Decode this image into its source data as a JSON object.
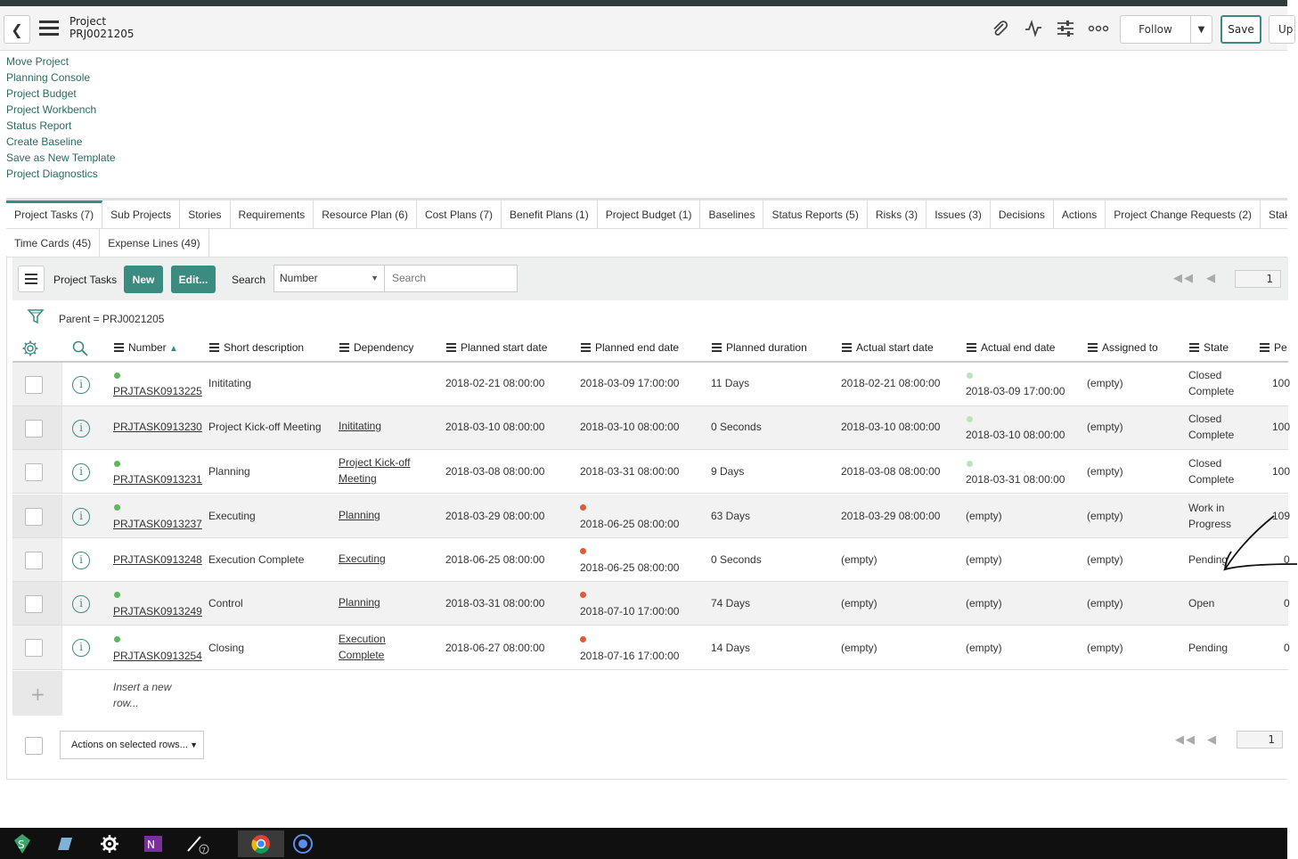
{
  "header": {
    "record_type": "Project",
    "record_number": "PRJ0021205",
    "follow_label": "Follow",
    "save_label": "Save",
    "update_label": "Up"
  },
  "related_links": [
    "Move Project",
    "Planning Console",
    "Project Budget",
    "Project Workbench",
    "Status Report",
    "Create Baseline",
    "Save as New Template",
    "Project Diagnostics"
  ],
  "tabs_row1": [
    "Project Tasks (7)",
    "Sub Projects",
    "Stories",
    "Requirements",
    "Resource Plan (6)",
    "Cost Plans (7)",
    "Benefit Plans (1)",
    "Project Budget (1)",
    "Baselines",
    "Status Reports (5)",
    "Risks (3)",
    "Issues (3)",
    "Decisions",
    "Actions",
    "Project Change Requests (2)",
    "Stakeh"
  ],
  "tabs_row2": [
    "Time Cards (45)",
    "Expense Lines (49)"
  ],
  "list": {
    "title": "Project Tasks",
    "new_label": "New",
    "edit_label": "Edit...",
    "search_label": "Search",
    "search_field": "Number",
    "search_placeholder": "Search",
    "page": "1",
    "breadcrumb": "Parent = PRJ0021205",
    "insert_text_1": "Insert a new",
    "insert_text_2": "row...",
    "actions_label": "Actions on selected rows..."
  },
  "columns": {
    "number": "Number",
    "short_description": "Short description",
    "dependency": "Dependency",
    "planned_start": "Planned start date",
    "planned_end": "Planned end date",
    "planned_duration": "Planned duration",
    "actual_start": "Actual start date",
    "actual_end": "Actual end date",
    "assigned_to": "Assigned to",
    "state": "State",
    "percent": "Pe"
  },
  "rows": [
    {
      "number": "PRJTASK0913225",
      "desc": "Inititating",
      "dep1": "",
      "dep2": "",
      "pstart": "2018-02-21 08:00:00",
      "pend": "2018-03-09 17:00:00",
      "dur": "11 Days",
      "astart": "2018-02-21 08:00:00",
      "aend": "2018-03-09 17:00:00",
      "assigned": "(empty)",
      "state1": "Closed",
      "state2": "Complete",
      "pct": "100"
    },
    {
      "number": "PRJTASK0913230",
      "desc": "Project Kick-off Meeting",
      "dep1": "Inititating",
      "dep2": "",
      "pstart": "2018-03-10 08:00:00",
      "pend": "2018-03-10 08:00:00",
      "dur": "0 Seconds",
      "astart": "2018-03-10 08:00:00",
      "aend": "2018-03-10 08:00:00",
      "assigned": "(empty)",
      "state1": "Closed",
      "state2": "Complete",
      "pct": "100"
    },
    {
      "number": "PRJTASK0913231",
      "desc": "Planning",
      "dep1": "Project Kick-off",
      "dep2": "Meeting",
      "pstart": "2018-03-08 08:00:00",
      "pend": "2018-03-31 08:00:00",
      "dur": "9 Days",
      "astart": "2018-03-08 08:00:00",
      "aend": "2018-03-31 08:00:00",
      "assigned": "(empty)",
      "state1": "Closed",
      "state2": "Complete",
      "pct": "100"
    },
    {
      "number": "PRJTASK0913237",
      "desc": "Executing",
      "dep1": "Planning",
      "dep2": "",
      "pstart": "2018-03-29 08:00:00",
      "pend": "2018-06-25 08:00:00",
      "dur": "63 Days",
      "astart": "2018-03-29 08:00:00",
      "aend": "(empty)",
      "assigned": "(empty)",
      "state1": "Work in",
      "state2": "Progress",
      "pct": "109"
    },
    {
      "number": "PRJTASK0913248",
      "desc": "Execution Complete",
      "dep1": "Executing",
      "dep2": "",
      "pstart": "2018-06-25 08:00:00",
      "pend": "2018-06-25 08:00:00",
      "dur": "0 Seconds",
      "astart": "(empty)",
      "aend": "(empty)",
      "assigned": "(empty)",
      "state1": "Pending",
      "state2": "",
      "pct": "0"
    },
    {
      "number": "PRJTASK0913249",
      "desc": "Control",
      "dep1": "Planning",
      "dep2": "",
      "pstart": "2018-03-31 08:00:00",
      "pend": "2018-07-10 17:00:00",
      "dur": "74 Days",
      "astart": "(empty)",
      "aend": "(empty)",
      "assigned": "(empty)",
      "state1": "Open",
      "state2": "",
      "pct": "0"
    },
    {
      "number": "PRJTASK0913254",
      "desc": "Closing",
      "dep1": "Execution",
      "dep2": "Complete",
      "pstart": "2018-06-27 08:00:00",
      "pend": "2018-07-16 17:00:00",
      "dur": "14 Days",
      "astart": "(empty)",
      "aend": "(empty)",
      "assigned": "(empty)",
      "state1": "Pending",
      "state2": "",
      "pct": "0"
    }
  ],
  "taskbar_apps": [
    "stealth-icon",
    "notepad-icon",
    "settings-icon",
    "onenote-icon",
    "pen-icon",
    "chrome-icon",
    "app-icon"
  ],
  "colors": {
    "accent": "#3c8b80",
    "link": "#2b6b61",
    "dot_green": "#5cb85c",
    "dot_red": "#e05a3a"
  }
}
